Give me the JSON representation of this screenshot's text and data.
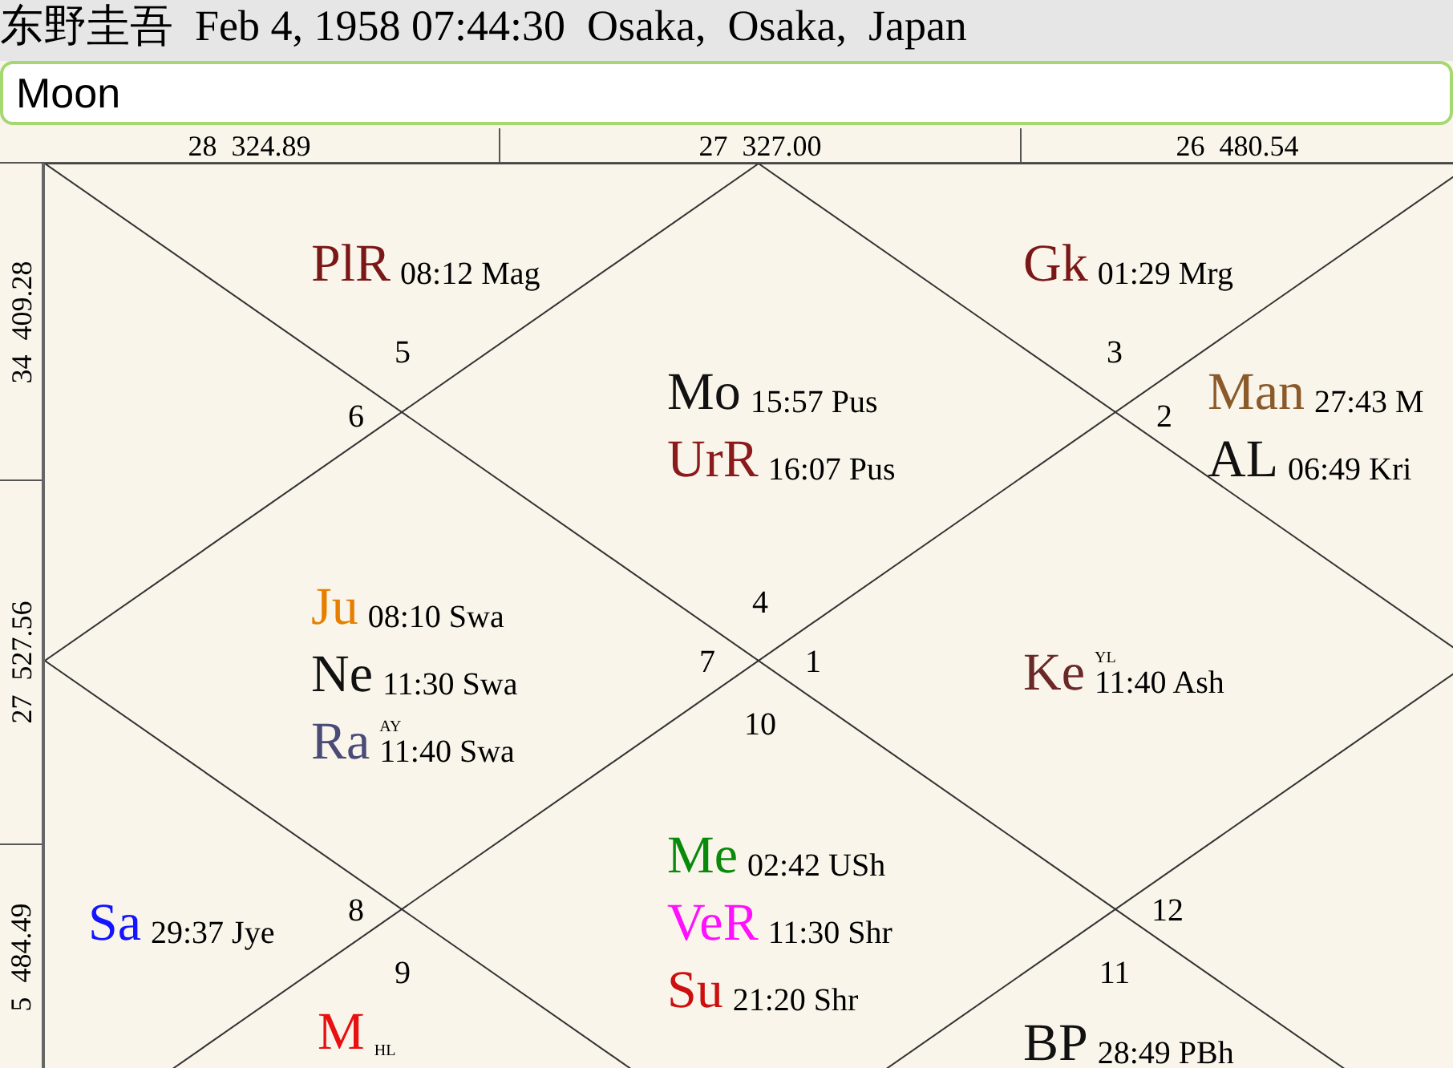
{
  "header": {
    "title": "东野圭吾  Feb 4, 1958 07:44:30  Osaka,  Osaka,  Japan"
  },
  "search": {
    "value": "Moon"
  },
  "top_ruler": [
    "28  324.89",
    "27  327.00",
    "26  480.54"
  ],
  "left_ruler": [
    "34  409.28",
    "27  527.56",
    "5  484.49"
  ],
  "houses": [
    {
      "sign": "5",
      "planets": [
        {
          "abbr": "PlR",
          "position": "08:12 Mag",
          "color": "#7a1818"
        }
      ]
    },
    {
      "sign": "3",
      "planets": [
        {
          "abbr": "Gk",
          "position": "01:29 Mrg",
          "color": "#7a1818"
        }
      ]
    },
    {
      "sign": "6"
    },
    {
      "sign": "4",
      "planets": [
        {
          "abbr": "Mo",
          "position": "15:57 Pus",
          "color": "#111111"
        },
        {
          "abbr": "UrR",
          "position": "16:07 Pus",
          "color": "#8b1a1a"
        }
      ]
    },
    {
      "sign": "2",
      "planets": [
        {
          "abbr": "Man",
          "position": "27:43 M",
          "color": "#8b5a2b"
        },
        {
          "abbr": "AL",
          "position": "06:49 Kri",
          "color": "#111111"
        }
      ]
    },
    {
      "sign": "7",
      "planets": [
        {
          "abbr": "Ju",
          "position": "08:10 Swa",
          "color": "#e67e00"
        },
        {
          "abbr": "Ne",
          "position": "11:30 Swa",
          "color": "#111111"
        },
        {
          "abbr": "Ra",
          "tag": "AY",
          "position": "11:40 Swa",
          "color": "#4b4b78"
        }
      ]
    },
    {
      "sign": "1",
      "planets": [
        {
          "abbr": "Ke",
          "tag": "YL",
          "position": "11:40 Ash",
          "color": "#6b2828"
        }
      ]
    },
    {
      "sign": "10",
      "planets": [
        {
          "abbr": "Me",
          "position": "02:42 USh",
          "color": "#0a8a0a"
        },
        {
          "abbr": "VeR",
          "position": "11:30 Shr",
          "color": "#ff10ff"
        },
        {
          "abbr": "Su",
          "position": "21:20 Shr",
          "color": "#cc1010"
        }
      ]
    },
    {
      "sign": "8",
      "planets": [
        {
          "abbr": "Sa",
          "position": "29:37 Jye",
          "color": "#1414ff"
        }
      ]
    },
    {
      "sign": "12"
    },
    {
      "sign": "9",
      "planets": [
        {
          "abbr": "M",
          "tag": "HL",
          "color": "#e81010"
        }
      ]
    },
    {
      "sign": "11",
      "planets": [
        {
          "abbr": "BP",
          "position": "28:49 PBh",
          "color": "#111111"
        }
      ]
    }
  ]
}
